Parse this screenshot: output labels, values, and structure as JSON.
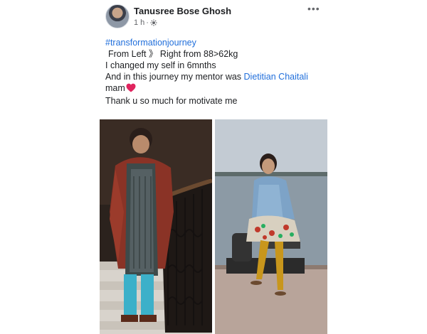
{
  "post": {
    "author": "Tanusree Bose Ghosh",
    "time": "1 h",
    "separator": "·",
    "privacy_icon": "globe-icon",
    "menu_icon": "more-icon",
    "hashtag": "#transformationjourney",
    "lines": {
      "l1": "From Left 》 Right   from 88>62kg",
      "l2": "I changed my self  in 6mnths",
      "l3_prefix": "And in this journey my mentor was ",
      "l3_mention": "Dietitian Chaitali",
      "l4": "mam",
      "l5": "Thank u so much for motivate me"
    },
    "emoji": "heart-icon",
    "colors": {
      "link": "#216fdb",
      "text": "#1c1e21",
      "meta": "#65676b",
      "heart": "#e0245e"
    }
  }
}
